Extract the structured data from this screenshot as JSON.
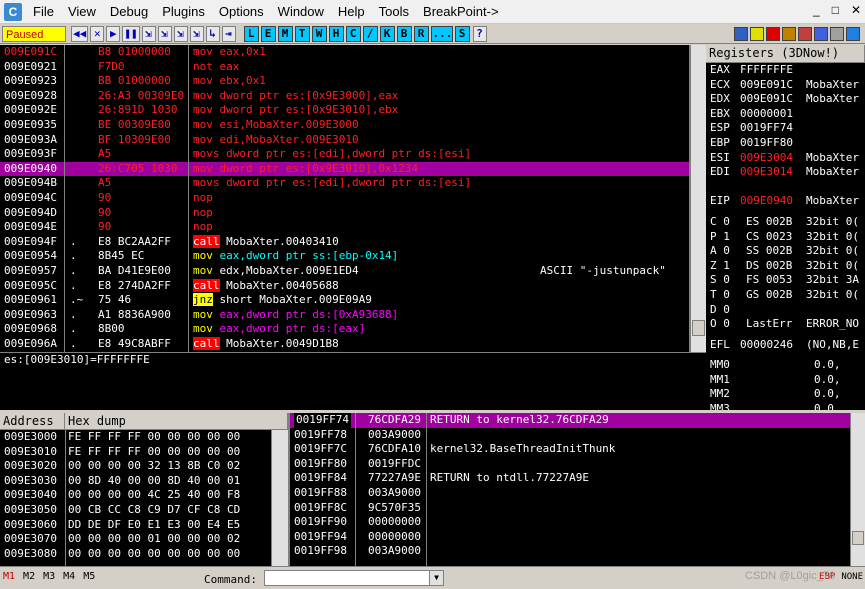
{
  "app": {
    "icon_letter": "C"
  },
  "menu": [
    "File",
    "View",
    "Debug",
    "Plugins",
    "Options",
    "Window",
    "Help",
    "Tools",
    "BreakPoint->"
  ],
  "window_controls": [
    "_",
    "□",
    "✕"
  ],
  "toolbar": {
    "status": "Paused",
    "buttons": [
      "◀◀",
      "✕",
      "▶",
      "❚❚",
      "⇲",
      "⇲",
      "⇲",
      "⇲",
      "↳",
      "⇥"
    ],
    "letters": [
      "L",
      "E",
      "M",
      "T",
      "W",
      "H",
      "C",
      "/",
      "K",
      "B",
      "R",
      "...",
      "S"
    ],
    "help": "?"
  },
  "disasm": {
    "rows": [
      {
        "addr": "009E091C",
        "mark": "",
        "hex": "B8 01000000",
        "asm": "mov eax,0x1",
        "comment": "",
        "style": "red"
      },
      {
        "addr": "009E0921",
        "mark": "",
        "hex": "F7D0",
        "asm": "not eax",
        "comment": "",
        "style": "red"
      },
      {
        "addr": "009E0923",
        "mark": "",
        "hex": "BB 01000000",
        "asm": "mov ebx,0x1",
        "comment": "",
        "style": "red"
      },
      {
        "addr": "009E0928",
        "mark": "",
        "hex": "26:A3 00309E0",
        "asm": "mov dword ptr es:[0x9E3000],eax",
        "comment": "",
        "style": "red"
      },
      {
        "addr": "009E092E",
        "mark": "",
        "hex": "26:891D 1030",
        "asm": "mov dword ptr es:[0x9E3010],ebx",
        "comment": "",
        "style": "red"
      },
      {
        "addr": "009E0935",
        "mark": "",
        "hex": "BE 00309E00",
        "asm": "mov esi,MobaXter.009E3000",
        "comment": "",
        "style": "red"
      },
      {
        "addr": "009E093A",
        "mark": "",
        "hex": "BF 10309E00",
        "asm": "mov edi,MobaXter.009E3010",
        "comment": "",
        "style": "red"
      },
      {
        "addr": "009E093F",
        "mark": "",
        "hex": "A5",
        "asm": "movs dword ptr es:[edi],dword ptr ds:[esi]",
        "comment": "",
        "style": "red"
      },
      {
        "addr": "009E0940",
        "mark": "",
        "hex": "26:C705 1030",
        "asm": "mov dword ptr es:[0x9E3010],0x1234",
        "comment": "",
        "style": "sel"
      },
      {
        "addr": "009E094B",
        "mark": "",
        "hex": "A5",
        "asm": "movs dword ptr es:[edi],dword ptr ds:[esi]",
        "comment": "",
        "style": "red"
      },
      {
        "addr": "009E094C",
        "mark": "",
        "hex": "90",
        "asm": "nop",
        "comment": "",
        "style": "red"
      },
      {
        "addr": "009E094D",
        "mark": "",
        "hex": "90",
        "asm": "nop",
        "comment": "",
        "style": "red"
      },
      {
        "addr": "009E094E",
        "mark": "",
        "hex": "90",
        "asm": "nop",
        "comment": "",
        "style": "red"
      },
      {
        "addr": "009E094F",
        "mark": ".",
        "hex": "E8 BC2AA2FF",
        "asm": "call MobaXter.00403410",
        "comment": "",
        "style": "call"
      },
      {
        "addr": "009E0954",
        "mark": ".",
        "hex": "8B45 EC",
        "asm": "mov eax,dword ptr ss:[ebp-0x14]",
        "comment": "",
        "style": "mov1"
      },
      {
        "addr": "009E0957",
        "mark": ".",
        "hex": "BA D41E9E00",
        "asm": "mov edx,MobaXter.009E1ED4",
        "comment": "ASCII \"-justunpack\"",
        "style": "mov2"
      },
      {
        "addr": "009E095C",
        "mark": ".",
        "hex": "E8 274DA2FF",
        "asm": "call MobaXter.00405688",
        "comment": "",
        "style": "call"
      },
      {
        "addr": "009E0961",
        "mark": ".~",
        "hex": "75 46",
        "asm": "jnz short MobaXter.009E09A9",
        "comment": "",
        "style": "jnz"
      },
      {
        "addr": "009E0963",
        "mark": ".",
        "hex": "A1 8836A900",
        "asm": "mov eax,dword ptr ds:[0xA93688]",
        "comment": "",
        "style": "mov3"
      },
      {
        "addr": "009E0968",
        "mark": ".",
        "hex": "8B00",
        "asm": "mov eax,dword ptr ds:[eax]",
        "comment": "",
        "style": "mov3"
      },
      {
        "addr": "009E096A",
        "mark": ".",
        "hex": "E8 49C8ABFF",
        "asm": "call MobaXter.0049D1B8",
        "comment": "",
        "style": "call"
      }
    ],
    "info": "es:[009E3010]=FFFFFFFE"
  },
  "registers": {
    "title": "Registers (3DNow!)",
    "general": [
      {
        "name": "EAX",
        "value": "FFFFFFFE",
        "extra": "",
        "highlight": false
      },
      {
        "name": "ECX",
        "value": "009E091C",
        "extra": "MobaXter",
        "highlight": false
      },
      {
        "name": "EDX",
        "value": "009E091C",
        "extra": "MobaXter",
        "highlight": false
      },
      {
        "name": "EBX",
        "value": "00000001",
        "extra": "",
        "highlight": false
      },
      {
        "name": "ESP",
        "value": "0019FF74",
        "extra": "",
        "highlight": false
      },
      {
        "name": "EBP",
        "value": "0019FF80",
        "extra": "",
        "highlight": false
      },
      {
        "name": "ESI",
        "value": "009E3004",
        "extra": "MobaXter",
        "highlight": true
      },
      {
        "name": "EDI",
        "value": "009E3014",
        "extra": "MobaXter",
        "highlight": true
      }
    ],
    "eip": {
      "name": "EIP",
      "value": "009E0940",
      "extra": "MobaXter"
    },
    "flags": [
      {
        "flag": "C 0",
        "seg": "ES 002B",
        "bits": "32bit 0("
      },
      {
        "flag": "P 1",
        "seg": "CS 0023",
        "bits": "32bit 0("
      },
      {
        "flag": "A 0",
        "seg": "SS 002B",
        "bits": "32bit 0("
      },
      {
        "flag": "Z 1",
        "seg": "DS 002B",
        "bits": "32bit 0("
      },
      {
        "flag": "S 0",
        "seg": "FS 0053",
        "bits": "32bit 3A"
      },
      {
        "flag": "T 0",
        "seg": "GS 002B",
        "bits": "32bit 0("
      },
      {
        "flag": "D 0",
        "seg": "",
        "bits": ""
      },
      {
        "flag": "O 0",
        "seg": "LastErr",
        "bits": "ERROR_NO"
      }
    ],
    "efl": {
      "name": "EFL",
      "value": "00000246",
      "extra": "(NO,NB,E"
    },
    "mmx": [
      {
        "name": "MM0",
        "value": "0.0,"
      },
      {
        "name": "MM1",
        "value": "0.0,"
      },
      {
        "name": "MM2",
        "value": "0.0,"
      },
      {
        "name": "MM3",
        "value": "0.0,"
      }
    ]
  },
  "dump": {
    "headers": {
      "address": "Address",
      "hex": "Hex dump"
    },
    "rows": [
      {
        "addr": "009E3000",
        "hex": "FE FF FF FF 00 00 00 00 00"
      },
      {
        "addr": "009E3010",
        "hex": "FE FF FF FF 00 00 00 00 00"
      },
      {
        "addr": "009E3020",
        "hex": "00 00 00 00 32 13 8B C0 02"
      },
      {
        "addr": "009E3030",
        "hex": "00 8D 40 00 00 8D 40 00 01"
      },
      {
        "addr": "009E3040",
        "hex": "00 00 00 00 4C 25 40 00 F8"
      },
      {
        "addr": "009E3050",
        "hex": "00 CB CC C8 C9 D7 CF C8 CD"
      },
      {
        "addr": "009E3060",
        "hex": "DD DE DF E0 E1 E3 00 E4 E5"
      },
      {
        "addr": "009E3070",
        "hex": "00 00 00 00 01 00 00 00 02"
      },
      {
        "addr": "009E3080",
        "hex": "00 00 00 00 00 00 00 00 00"
      }
    ]
  },
  "stack": {
    "rows": [
      {
        "addr": "0019FF74",
        "value": "76CDFA29",
        "comment": "RETURN to kernel32.76CDFA29",
        "selected": true
      },
      {
        "addr": "0019FF78",
        "value": "003A9000",
        "comment": "",
        "selected": false
      },
      {
        "addr": "0019FF7C",
        "value": "76CDFA10",
        "comment": "kernel32.BaseThreadInitThunk",
        "selected": false
      },
      {
        "addr": "0019FF80",
        "value": "0019FFDC",
        "comment": "",
        "selected": false
      },
      {
        "addr": "0019FF84",
        "value": "77227A9E",
        "comment": "RETURN to ntdll.77227A9E",
        "selected": false
      },
      {
        "addr": "0019FF88",
        "value": "003A9000",
        "comment": "",
        "selected": false
      },
      {
        "addr": "0019FF8C",
        "value": "9C570F35",
        "comment": "",
        "selected": false
      },
      {
        "addr": "0019FF90",
        "value": "00000000",
        "comment": "",
        "selected": false
      },
      {
        "addr": "0019FF94",
        "value": "00000000",
        "comment": "",
        "selected": false
      },
      {
        "addr": "0019FF98",
        "value": "003A9000",
        "comment": "",
        "selected": false
      }
    ]
  },
  "statusbar": {
    "mem_tabs": [
      "M1",
      "M2",
      "M3",
      "M4",
      "M5"
    ],
    "command_label": "Command:",
    "command_value": "",
    "right": [
      "EBP",
      "NONE"
    ],
    "watermark": "CSDN @L0gic_76"
  }
}
